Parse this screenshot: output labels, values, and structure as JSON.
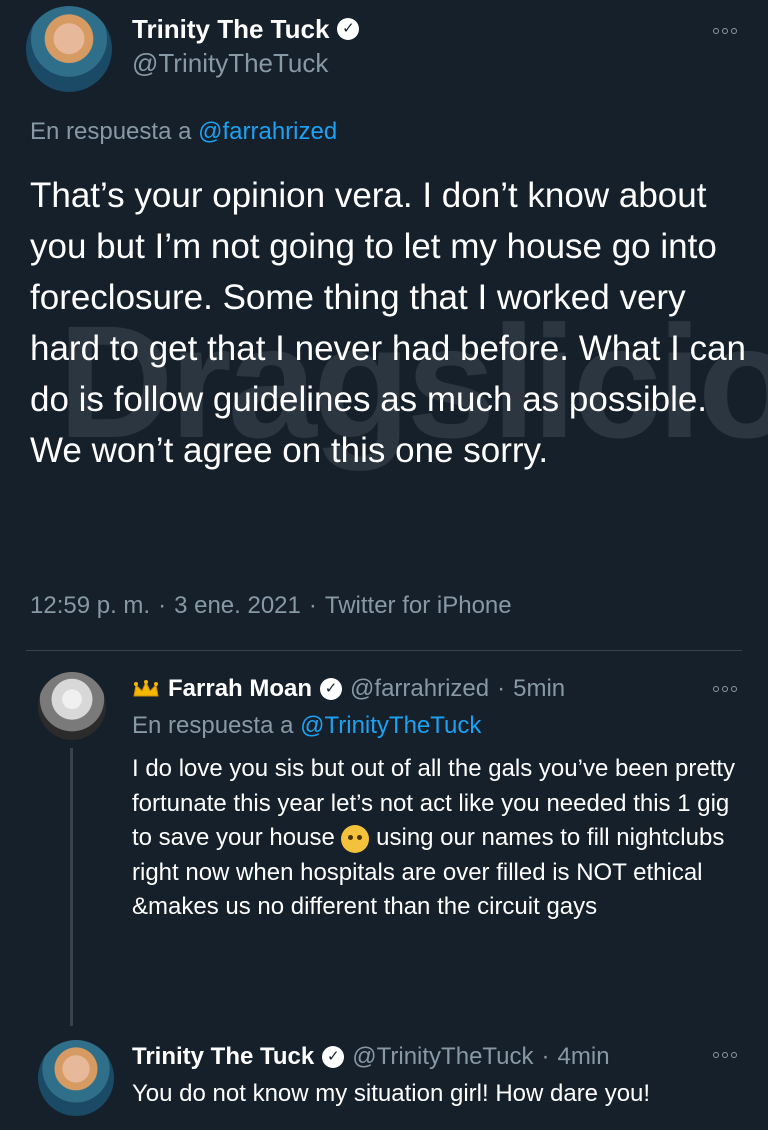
{
  "main_tweet": {
    "author_name": "Trinity The Tuck",
    "author_handle": "@TrinityTheTuck",
    "reply_prefix": "En respuesta a",
    "reply_to": "@farrahrized",
    "text": "That’s your opinion vera. I don’t know about you but I’m not going to let my house go into foreclosure. Some thing that I worked very hard to get that I never had before. What I can do is follow guidelines as much as possible. We won’t agree on this one sorry.",
    "time": "12:59 p. m.",
    "sep1": "·",
    "date": "3 ene. 2021",
    "sep2": "·",
    "source": "Twitter for iPhone"
  },
  "watermark": {
    "text": "Dragslicious"
  },
  "reply_1": {
    "author_name": "Farrah Moan",
    "author_handle": "@farrahrized",
    "sep": "·",
    "time_ago": "5min",
    "reply_prefix": "En respuesta a",
    "reply_to": "@TrinityTheTuck",
    "text_part1": "I do love you sis but out of all the gals you’ve been pretty fortunate this year let’s not act like you needed this 1 gig to save your house",
    "text_part2": "using our names to fill nightclubs right now when hospitals are over filled is NOT ethical &makes us no different than the circuit gays"
  },
  "reply_2": {
    "author_name": "Trinity The Tuck",
    "author_handle": "@TrinityTheTuck",
    "sep": "·",
    "time_ago": "4min",
    "text": "You do not know my situation girl! How dare you!"
  },
  "icons": {
    "verified": "verified-badge-icon",
    "more": "more-options-icon",
    "crown": "crown-emoji-icon",
    "face": "raised-eyebrow-emoji-icon"
  },
  "colors": {
    "background": "#15202b",
    "text": "#ffffff",
    "muted": "#8899a6",
    "link": "#1da1f2",
    "divider": "#38444d"
  }
}
